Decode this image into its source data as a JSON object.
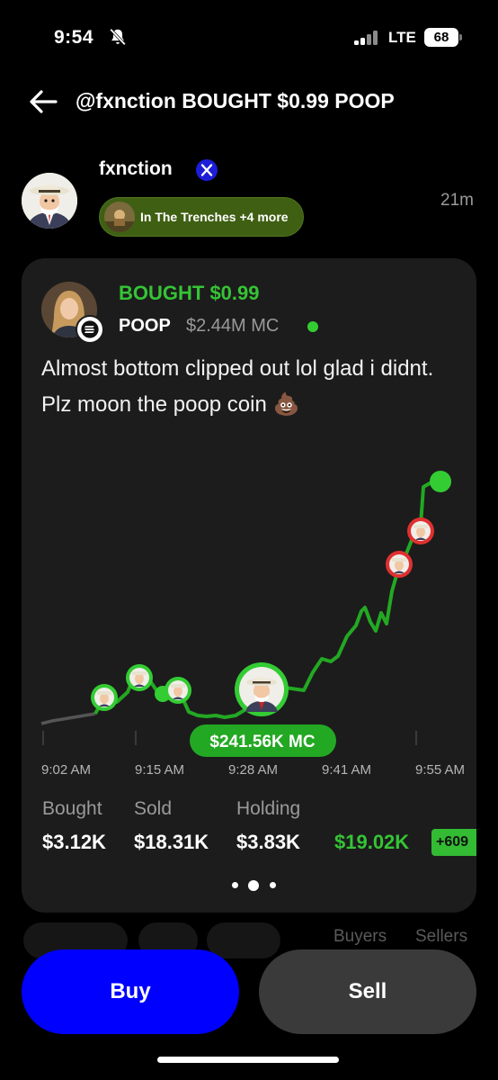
{
  "status_bar": {
    "time": "9:54",
    "network": "LTE",
    "battery": "68"
  },
  "header": {
    "title": "@fxnction BOUGHT $0.99 POOP"
  },
  "poster": {
    "name": "fxnction",
    "group_label": "In The Trenches +4 more",
    "age": "21m"
  },
  "post": {
    "action": "BOUGHT $0.99",
    "token": "POOP",
    "market_cap": "$2.44M MC",
    "text": "Almost bottom clipped out lol glad i didnt. Plz moon the poop coin 💩"
  },
  "chart_data": {
    "type": "line",
    "x_ticks": [
      "9:02 AM",
      "9:15 AM",
      "9:28 AM",
      "9:41 AM",
      "9:55 AM"
    ],
    "callout": "$241.56K MC",
    "accent_color": "#35c435",
    "sell_marker_color": "#e03030",
    "line_color": "#23a823",
    "pre_entry_color": "#555555"
  },
  "stats": [
    {
      "label": "Bought",
      "value": "$3.12K"
    },
    {
      "label": "Sold",
      "value": "$18.31K"
    },
    {
      "label": "Holding",
      "value": "$3.83K"
    }
  ],
  "pnl": {
    "value": "$19.02K",
    "badge": "+609"
  },
  "pager": {
    "count": 3,
    "active": 1
  },
  "tabs": {
    "buyers": "Buyers",
    "sellers": "Sellers"
  },
  "actions": {
    "buy": "Buy",
    "sell": "Sell"
  }
}
